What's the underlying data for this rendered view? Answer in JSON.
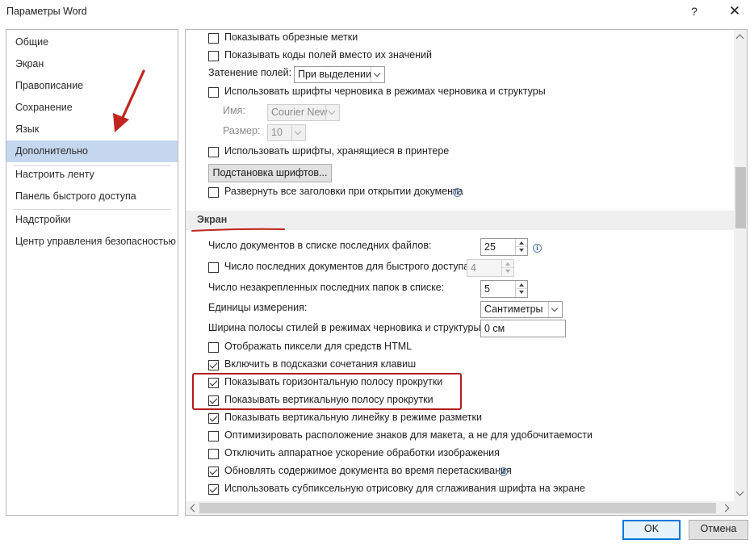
{
  "window": {
    "title": "Параметры Word",
    "help": "?",
    "close": "✕"
  },
  "nav": {
    "items": [
      {
        "label": "Общие"
      },
      {
        "label": "Экран"
      },
      {
        "label": "Правописание"
      },
      {
        "label": "Сохранение"
      },
      {
        "label": "Язык"
      },
      {
        "label": "Дополнительно",
        "selected": true
      },
      {
        "label": "Настроить ленту"
      },
      {
        "label": "Панель быстрого доступа"
      },
      {
        "label": "Надстройки"
      },
      {
        "label": "Центр управления безопасностью"
      }
    ]
  },
  "options_top": {
    "show_crop_marks": {
      "label": "Показывать обрезные метки",
      "checked": false
    },
    "show_field_codes": {
      "label": "Показывать коды полей вместо их значений",
      "checked": false
    },
    "field_shading": {
      "label": "Затенение полей:",
      "value": "При выделении"
    },
    "draft_font": {
      "label": "Использовать шрифты черновика в режимах черновика и структуры",
      "checked": false
    },
    "font_name": {
      "label": "Имя:",
      "value": "Courier New"
    },
    "font_size": {
      "label": "Размер:",
      "value": "10"
    },
    "printer_fonts": {
      "label": "Использовать шрифты, хранящиеся в принтере",
      "checked": false
    },
    "font_substitution_button": "Подстановка шрифтов...",
    "expand_headings": {
      "label": "Развернуть все заголовки при открытии документа",
      "checked": false
    }
  },
  "display_section": {
    "title": "Экран",
    "recent_docs": {
      "label": "Число документов в списке последних файлов:",
      "value": "25"
    },
    "quick_access_docs": {
      "label": "Число последних документов для быстрого доступа:",
      "value": "4",
      "checked": false
    },
    "recent_folders": {
      "label": "Число незакрепленных последних папок в списке:",
      "value": "5"
    },
    "units": {
      "label": "Единицы измерения:",
      "value": "Сантиметры"
    },
    "style_pane_width": {
      "label": "Ширина полосы стилей в режимах черновика и структуры:",
      "value": "0 см"
    },
    "checkboxes": [
      {
        "label": "Отображать пиксели для средств HTML",
        "checked": false
      },
      {
        "label": "Включить в подсказки сочетания клавиш",
        "checked": true
      },
      {
        "label": "Показывать горизонтальную полосу прокрутки",
        "checked": true
      },
      {
        "label": "Показывать вертикальную полосу прокрутки",
        "checked": true
      },
      {
        "label": "Показывать вертикальную линейку в режиме разметки",
        "checked": true
      },
      {
        "label": "Оптимизировать расположение знаков для макета, а не для удобочитаемости",
        "checked": false
      },
      {
        "label": "Отключить аппаратное ускорение обработки изображения",
        "checked": false
      },
      {
        "label": "Обновлять содержимое документа во время перетаскивания",
        "checked": true,
        "info": true
      },
      {
        "label": "Использовать субпиксельную отрисовку для сглаживания шрифта на экране",
        "checked": true
      }
    ]
  },
  "footer": {
    "ok": "OK",
    "cancel": "Отмена"
  },
  "colors": {
    "selection": "#c5d7ef",
    "annotation": "#b31b1b",
    "accent": "#0078d7"
  }
}
